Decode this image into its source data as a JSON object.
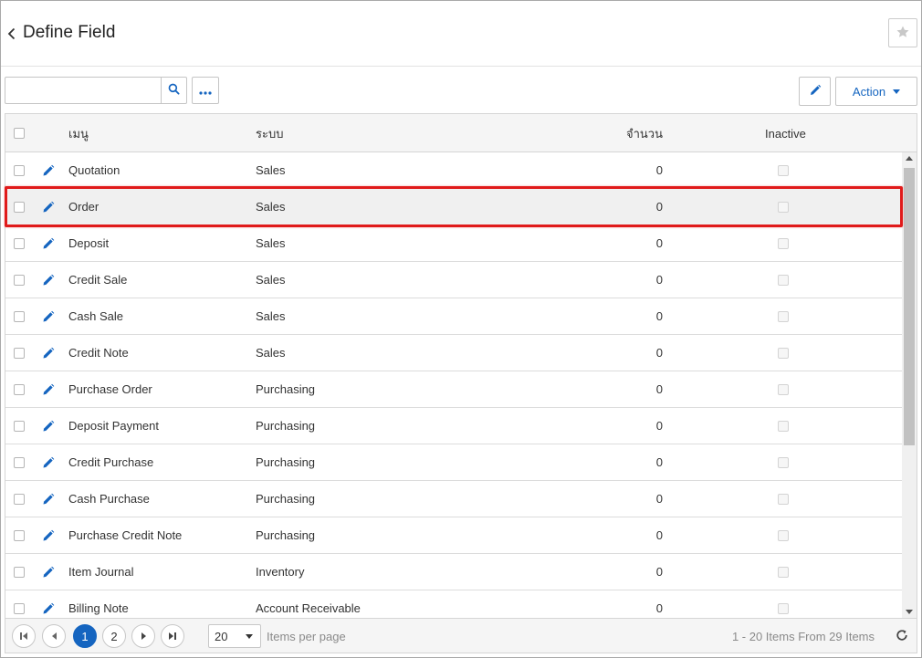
{
  "header": {
    "title": "Define Field"
  },
  "toolbar": {
    "search_value": "",
    "search_placeholder": "",
    "action_label": "Action"
  },
  "table": {
    "columns": {
      "menu": "เมนู",
      "system": "ระบบ",
      "quantity": "จำนวน",
      "inactive": "Inactive"
    },
    "rows": [
      {
        "menu": "Quotation",
        "system": "Sales",
        "quantity": "0",
        "inactive": false
      },
      {
        "menu": "Order",
        "system": "Sales",
        "quantity": "0",
        "inactive": false,
        "selected": true
      },
      {
        "menu": "Deposit",
        "system": "Sales",
        "quantity": "0",
        "inactive": false
      },
      {
        "menu": "Credit Sale",
        "system": "Sales",
        "quantity": "0",
        "inactive": false
      },
      {
        "menu": "Cash Sale",
        "system": "Sales",
        "quantity": "0",
        "inactive": false
      },
      {
        "menu": "Credit Note",
        "system": "Sales",
        "quantity": "0",
        "inactive": false
      },
      {
        "menu": "Purchase Order",
        "system": "Purchasing",
        "quantity": "0",
        "inactive": false
      },
      {
        "menu": "Deposit Payment",
        "system": "Purchasing",
        "quantity": "0",
        "inactive": false
      },
      {
        "menu": "Credit Purchase",
        "system": "Purchasing",
        "quantity": "0",
        "inactive": false
      },
      {
        "menu": "Cash Purchase",
        "system": "Purchasing",
        "quantity": "0",
        "inactive": false
      },
      {
        "menu": "Purchase Credit Note",
        "system": "Purchasing",
        "quantity": "0",
        "inactive": false
      },
      {
        "menu": "Item Journal",
        "system": "Inventory",
        "quantity": "0",
        "inactive": false
      },
      {
        "menu": "Billing Note",
        "system": "Account Receivable",
        "quantity": "0",
        "inactive": false
      }
    ]
  },
  "pager": {
    "pages": [
      "1",
      "2"
    ],
    "current_page": "1",
    "page_size": "20",
    "per_page_label": "Items per page",
    "info": "1 - 20 Items From 29 Items"
  },
  "colors": {
    "accent": "#1565c0",
    "highlight": "#e01a1a"
  },
  "icons": {
    "back": "chevron-left-icon",
    "favorite": "star-icon",
    "search": "search-icon",
    "more": "more-horizontal-icon",
    "edit": "pencil-icon",
    "refresh": "refresh-icon"
  }
}
